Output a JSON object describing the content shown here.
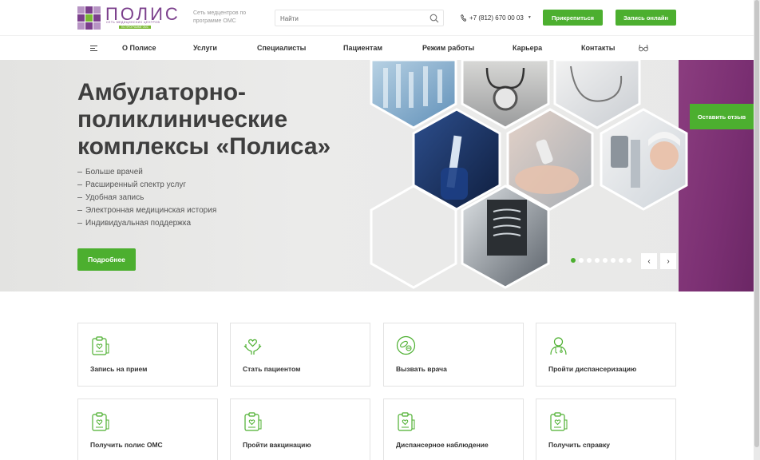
{
  "header": {
    "logo_text": "ПОЛИС",
    "logo_subtitle": "СЕТЬ МЕДИЦИНСКИХ ЦЕНТРОВ",
    "logo_tag": "ПО ПРОГРАММЕ ОМС",
    "tagline": "Сеть медцентров по программе ОМС",
    "search_placeholder": "Найти",
    "phone": "+7 (812) 670 00 03",
    "attach_label": "Прикрепиться",
    "online_label": "Запись онлайн",
    "brand_purple": "#7b3f8c",
    "brand_green": "#4caf2f"
  },
  "nav": {
    "items": [
      "О Полисе",
      "Услуги",
      "Специалисты",
      "Пациентам",
      "Режим работы",
      "Карьера",
      "Контакты"
    ]
  },
  "hero": {
    "title": "Амбулаторно-поликлинические комплексы «Полиса»",
    "bullets": [
      "Больше врачей",
      "Расширенный спектр услуг",
      "Удобная запись",
      "Электронная медицинская история",
      "Индивидуальная поддержка"
    ],
    "more_label": "Подробнее",
    "review_label": "Оставить отзыв",
    "slide_count": 8,
    "active_slide": 1,
    "prev_icon": "chevron-left-icon",
    "next_icon": "chevron-right-icon"
  },
  "services": [
    {
      "label": "Запись на прием",
      "icon": "clipboard-heart-icon"
    },
    {
      "label": "Стать пациентом",
      "icon": "hands-heart-icon"
    },
    {
      "label": "Вызвать врача",
      "icon": "pills-icon"
    },
    {
      "label": "Пройти диспансеризацию",
      "icon": "doctor-icon"
    },
    {
      "label": "Получить полис ОМС",
      "icon": "clipboard-heart-icon"
    },
    {
      "label": "Пройти вакцинацию",
      "icon": "clipboard-heart-icon"
    },
    {
      "label": "Диспансерное наблюдение",
      "icon": "clipboard-heart-icon"
    },
    {
      "label": "Получить справку",
      "icon": "clipboard-heart-icon"
    }
  ]
}
